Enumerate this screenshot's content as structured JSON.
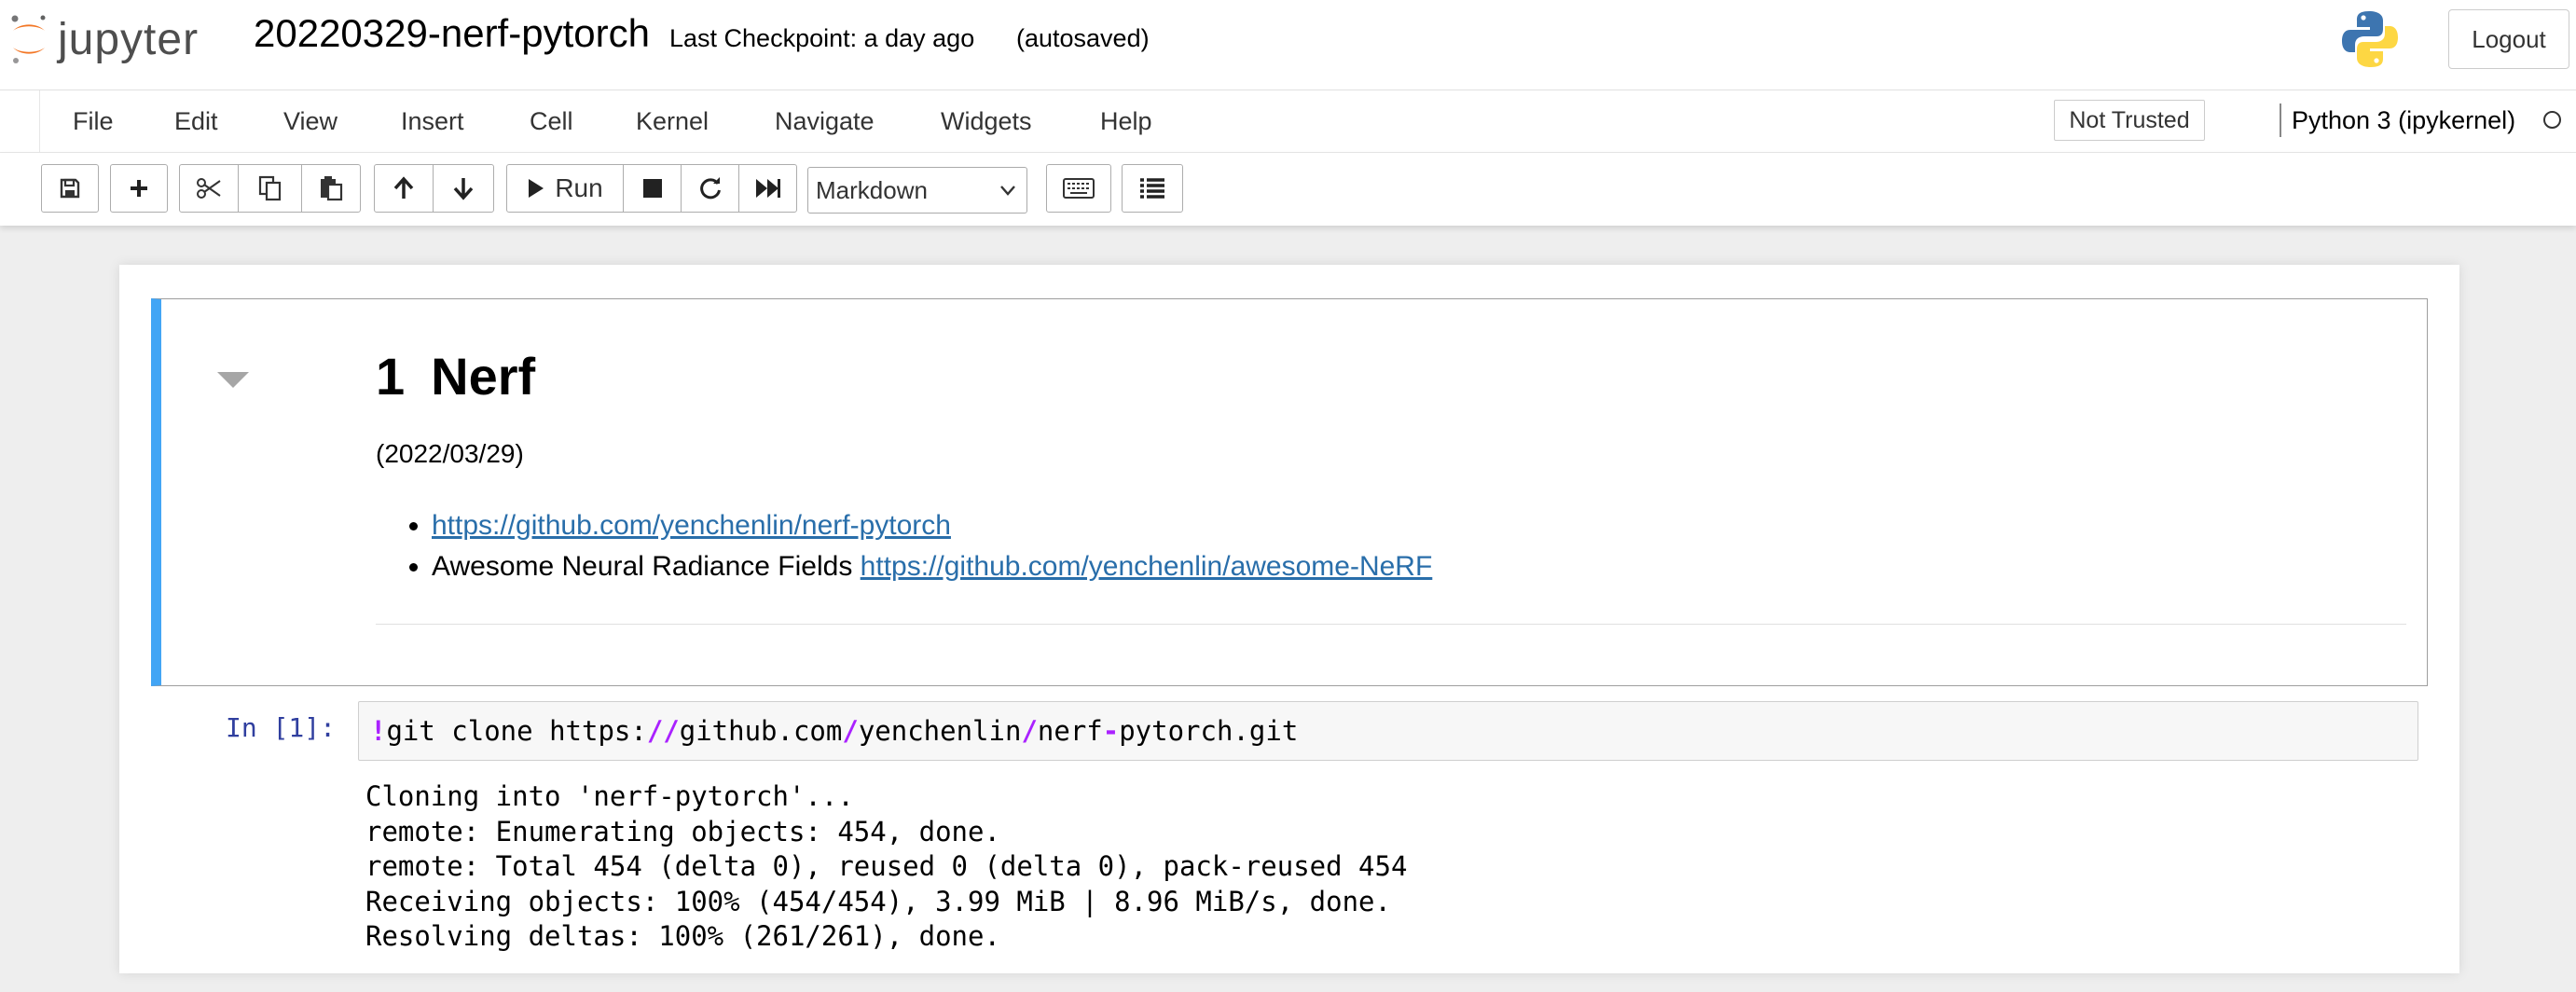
{
  "header": {
    "logo_text": "jupyter",
    "notebook_title": "20220329-nerf-pytorch",
    "checkpoint_text": "Last Checkpoint: a day ago",
    "autosave_text": "(autosaved)",
    "logout_label": "Logout"
  },
  "menubar": {
    "items": [
      "File",
      "Edit",
      "View",
      "Insert",
      "Cell",
      "Kernel",
      "Navigate",
      "Widgets",
      "Help"
    ],
    "trust_label": "Not Trusted",
    "kernel_name": "Python 3 (ipykernel)"
  },
  "toolbar": {
    "run_label": "Run",
    "cell_type": "Markdown",
    "icons": [
      "save-icon",
      "plus-icon",
      "cut-icon",
      "copy-icon",
      "paste-icon",
      "arrow-up-icon",
      "arrow-down-icon",
      "play-icon",
      "stop-icon",
      "restart-icon",
      "fast-forward-icon",
      "keyboard-icon",
      "list-icon"
    ]
  },
  "markdown_cell": {
    "heading_number": "1",
    "heading_text": "Nerf",
    "date": "(2022/03/29)",
    "links": [
      {
        "prefix": "",
        "url": "https://github.com/yenchenlin/nerf-pytorch"
      },
      {
        "prefix": "Awesome Neural Radiance Fields ",
        "url": "https://github.com/yenchenlin/awesome-NeRF"
      }
    ]
  },
  "code_cell": {
    "prompt": "In [1]:",
    "code": {
      "bang": "!",
      "cmd": "git clone https:",
      "slash2": "//",
      "host": "github.com",
      "slash_a": "/",
      "user": "yenchenlin",
      "slash_b": "/",
      "repo_a": "nerf",
      "dash": "-",
      "repo_b": "pytorch.git"
    },
    "output_lines": [
      "Cloning into 'nerf-pytorch'...",
      "remote: Enumerating objects: 454, done.",
      "remote: Total 454 (delta 0), reused 0 (delta 0), pack-reused 454",
      "Receiving objects: 100% (454/454), 3.99 MiB | 8.96 MiB/s, done.",
      "Resolving deltas: 100% (261/261), done."
    ]
  },
  "colors": {
    "accent_blue": "#42a5f5",
    "link": "#296eaa",
    "prompt": "#303f9f",
    "operator": "#aa22ff",
    "jupyter_orange": "#f37726"
  }
}
